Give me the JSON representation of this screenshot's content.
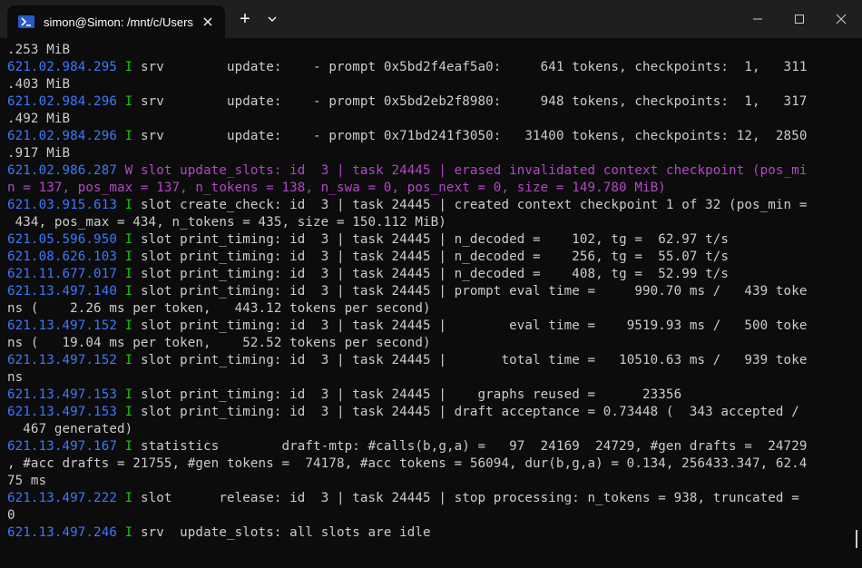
{
  "window": {
    "tab_title": "simon@Simon: /mnt/c/Users/a",
    "new_tab_label": "+",
    "colors": {
      "timestamp": "#3b78ff",
      "info": "#16c60c",
      "warn": "#b148c6",
      "text": "#cccccc",
      "background": "#0c0c0c"
    }
  },
  "terminal": {
    "lines": [
      {
        "ts": "",
        "lv": "",
        "msg": ".253 MiB"
      },
      {
        "ts": "621.02.984.295",
        "lv": "I",
        "msg": " srv        update:    - prompt 0x5bd2f4eaf5a0:     641 tokens, checkpoints:  1,   311"
      },
      {
        "ts": "",
        "lv": "",
        "msg": ".403 MiB"
      },
      {
        "ts": "621.02.984.296",
        "lv": "I",
        "msg": " srv        update:    - prompt 0x5bd2eb2f8980:     948 tokens, checkpoints:  1,   317"
      },
      {
        "ts": "",
        "lv": "",
        "msg": ".492 MiB"
      },
      {
        "ts": "621.02.984.296",
        "lv": "I",
        "msg": " srv        update:    - prompt 0x71bd241f3050:   31400 tokens, checkpoints: 12,  2850"
      },
      {
        "ts": "",
        "lv": "",
        "msg": ".917 MiB"
      },
      {
        "ts": "621.02.986.287",
        "lv": "W",
        "msg": " slot update_slots: id  3 | task 24445 | erased invalidated context checkpoint (pos_mi",
        "warn": true
      },
      {
        "ts": "",
        "lv": "",
        "msg": "n = 137, pos_max = 137, n_tokens = 138, n_swa = 0, pos_next = 0, size = 149.780 MiB)",
        "warn": true
      },
      {
        "ts": "621.03.915.613",
        "lv": "I",
        "msg": " slot create_check: id  3 | task 24445 | created context checkpoint 1 of 32 (pos_min ="
      },
      {
        "ts": "",
        "lv": "",
        "msg": " 434, pos_max = 434, n_tokens = 435, size = 150.112 MiB)"
      },
      {
        "ts": "621.05.596.950",
        "lv": "I",
        "msg": " slot print_timing: id  3 | task 24445 | n_decoded =    102, tg =  62.97 t/s"
      },
      {
        "ts": "621.08.626.103",
        "lv": "I",
        "msg": " slot print_timing: id  3 | task 24445 | n_decoded =    256, tg =  55.07 t/s"
      },
      {
        "ts": "621.11.677.017",
        "lv": "I",
        "msg": " slot print_timing: id  3 | task 24445 | n_decoded =    408, tg =  52.99 t/s"
      },
      {
        "ts": "621.13.497.140",
        "lv": "I",
        "msg": " slot print_timing: id  3 | task 24445 | prompt eval time =     990.70 ms /   439 toke"
      },
      {
        "ts": "",
        "lv": "",
        "msg": "ns (    2.26 ms per token,   443.12 tokens per second)"
      },
      {
        "ts": "621.13.497.152",
        "lv": "I",
        "msg": " slot print_timing: id  3 | task 24445 |        eval time =    9519.93 ms /   500 toke"
      },
      {
        "ts": "",
        "lv": "",
        "msg": "ns (   19.04 ms per token,    52.52 tokens per second)"
      },
      {
        "ts": "621.13.497.152",
        "lv": "I",
        "msg": " slot print_timing: id  3 | task 24445 |       total time =   10510.63 ms /   939 toke"
      },
      {
        "ts": "",
        "lv": "",
        "msg": "ns"
      },
      {
        "ts": "621.13.497.153",
        "lv": "I",
        "msg": " slot print_timing: id  3 | task 24445 |    graphs reused =      23356"
      },
      {
        "ts": "621.13.497.153",
        "lv": "I",
        "msg": " slot print_timing: id  3 | task 24445 | draft acceptance = 0.73448 (  343 accepted /"
      },
      {
        "ts": "",
        "lv": "",
        "msg": "  467 generated)"
      },
      {
        "ts": "621.13.497.167",
        "lv": "I",
        "msg": " statistics        draft-mtp: #calls(b,g,a) =   97  24169  24729, #gen drafts =  24729"
      },
      {
        "ts": "",
        "lv": "",
        "msg": ", #acc drafts = 21755, #gen tokens =  74178, #acc tokens = 56094, dur(b,g,a) = 0.134, 256433.347, 62.4"
      },
      {
        "ts": "",
        "lv": "",
        "msg": "75 ms"
      },
      {
        "ts": "621.13.497.222",
        "lv": "I",
        "msg": " slot      release: id  3 | task 24445 | stop processing: n_tokens = 938, truncated ="
      },
      {
        "ts": "",
        "lv": "",
        "msg": "0"
      },
      {
        "ts": "621.13.497.246",
        "lv": "I",
        "msg": " srv  update_slots: all slots are idle"
      }
    ]
  }
}
